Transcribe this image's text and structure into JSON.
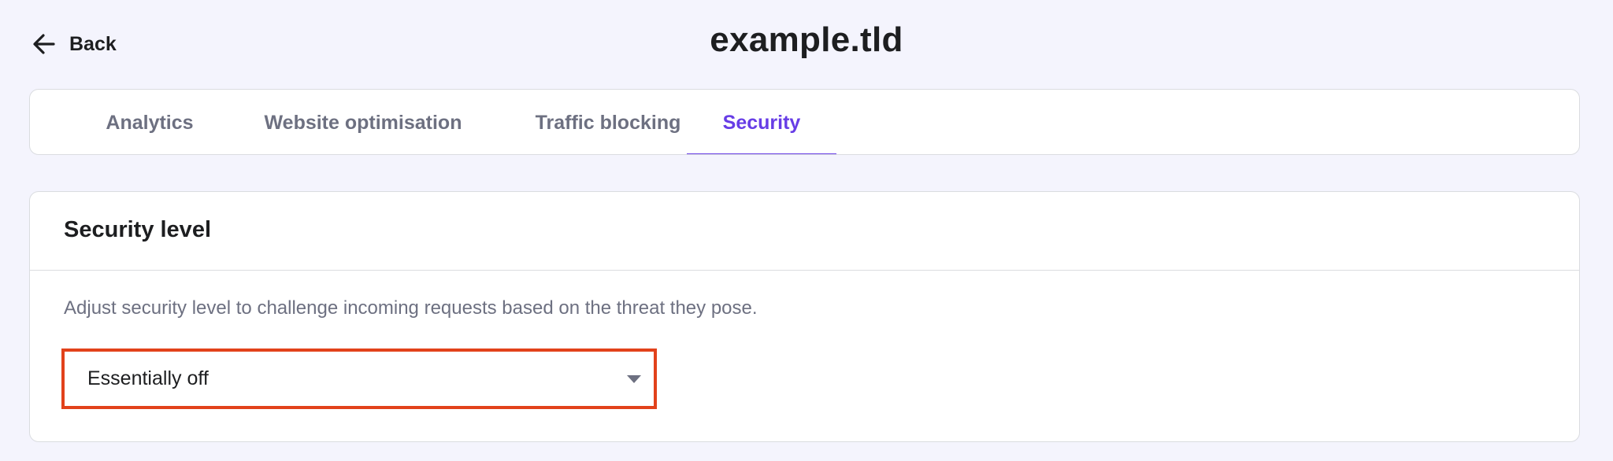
{
  "header": {
    "back_label": "Back",
    "title": "example.tld"
  },
  "tabs": [
    {
      "label": "Analytics",
      "active": false
    },
    {
      "label": "Website optimisation",
      "active": false
    },
    {
      "label": "Traffic blocking",
      "active": false
    },
    {
      "label": "Security",
      "active": true
    }
  ],
  "security_level": {
    "title": "Security level",
    "description": "Adjust security level to challenge incoming requests based on the threat they pose.",
    "selected_value": "Essentially off"
  },
  "icons": {
    "back": "arrow-left-icon",
    "select": "caret-down-icon"
  },
  "colors": {
    "background": "#f4f4fd",
    "accent": "#673de6",
    "highlight": "#e2421b",
    "muted_text": "#6d7081"
  }
}
